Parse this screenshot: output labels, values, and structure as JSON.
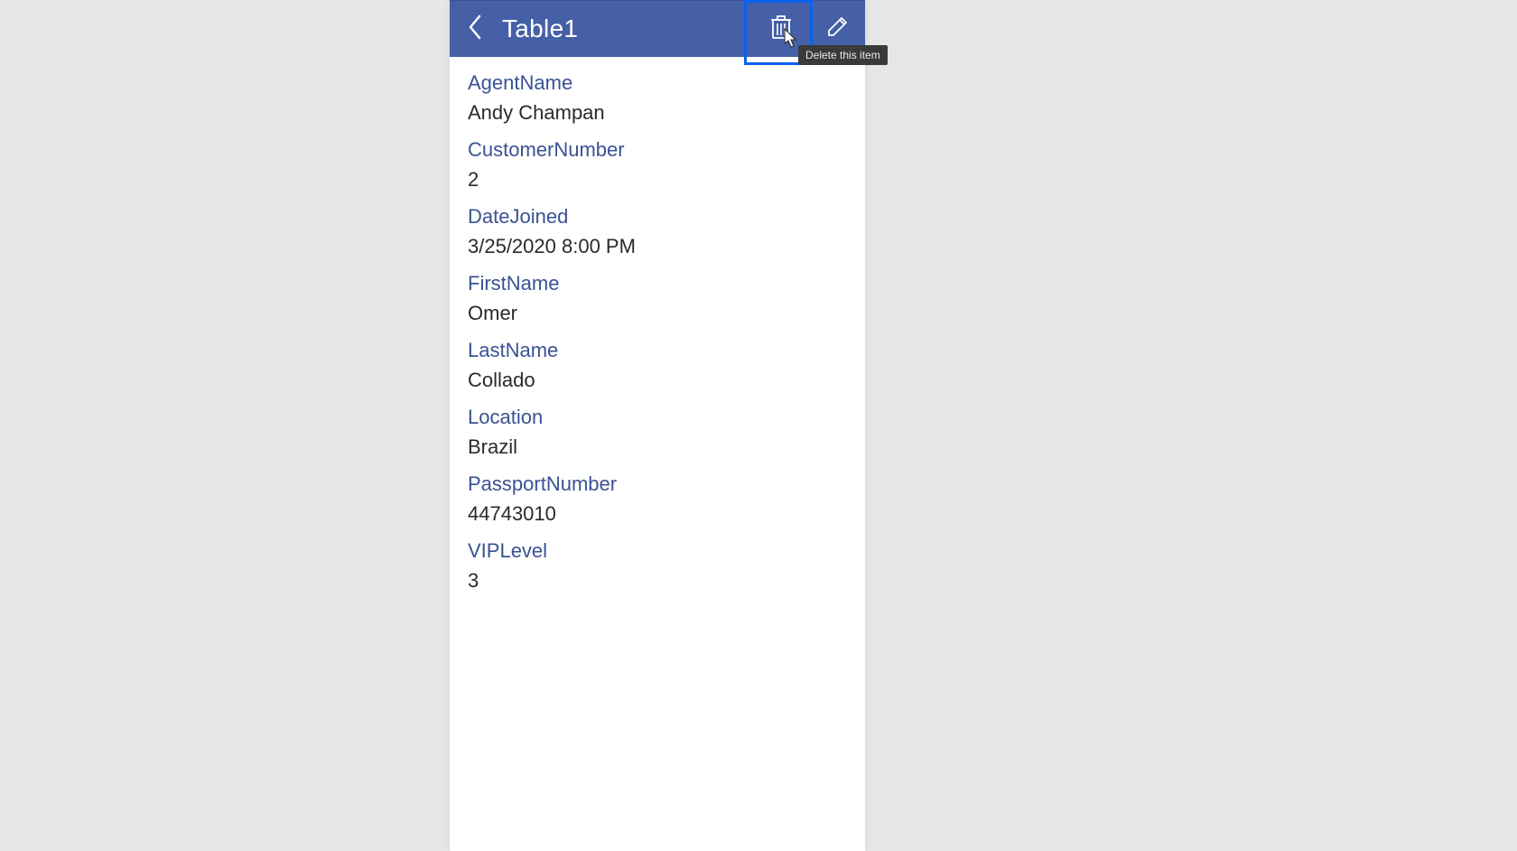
{
  "header": {
    "title": "Table1",
    "delete_tooltip": "Delete this item"
  },
  "fields": [
    {
      "label": "AgentName",
      "value": "Andy Champan"
    },
    {
      "label": "CustomerNumber",
      "value": "2"
    },
    {
      "label": "DateJoined",
      "value": "3/25/2020 8:00 PM"
    },
    {
      "label": "FirstName",
      "value": "Omer"
    },
    {
      "label": "LastName",
      "value": "Collado"
    },
    {
      "label": "Location",
      "value": "Brazil"
    },
    {
      "label": "PassportNumber",
      "value": "44743010"
    },
    {
      "label": "VIPLevel",
      "value": "3"
    }
  ]
}
